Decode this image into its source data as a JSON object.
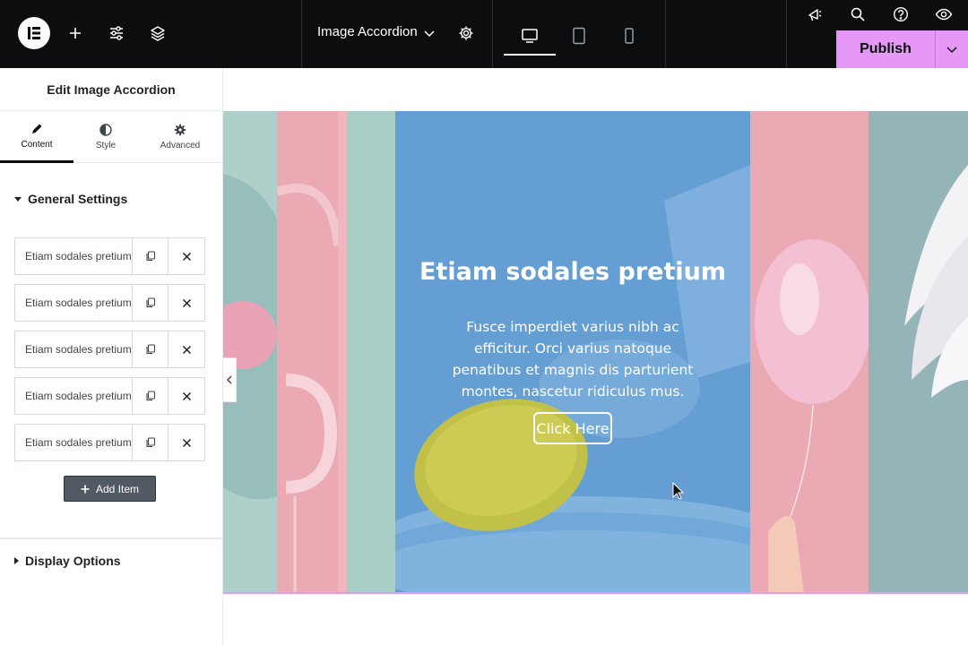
{
  "topbar": {
    "document_title": "Image Accordion",
    "publish_label": "Publish",
    "icons": [
      "elementor-logo-icon",
      "plus-icon",
      "sliders-icon",
      "layers-icon",
      "chevron-down-icon",
      "gear-icon",
      "desktop-icon",
      "tablet-icon",
      "mobile-icon",
      "megaphone-icon",
      "search-icon",
      "help-icon",
      "eye-icon"
    ],
    "accent": "#e598f5"
  },
  "panel": {
    "title": "Edit Image Accordion",
    "tabs": [
      {
        "label": "Content",
        "active": true
      },
      {
        "label": "Style",
        "active": false
      },
      {
        "label": "Advanced",
        "active": false
      }
    ],
    "general_settings_label": "General Settings",
    "items": [
      {
        "label": "Etiam sodales pretium"
      },
      {
        "label": "Etiam sodales pretium"
      },
      {
        "label": "Etiam sodales pretium"
      },
      {
        "label": "Etiam sodales pretium"
      },
      {
        "label": "Etiam sodales pretium"
      }
    ],
    "add_item_label": "Add Item",
    "display_options_label": "Display Options"
  },
  "accordion": {
    "active_title": "Etiam sodales pretium",
    "active_description": "Fusce imperdiet varius nibh ac efficitur. Orci varius natoque penatibus et magnis dis parturient montes, nascetur ridiculus mus.",
    "button_label": "Click Here",
    "colors": {
      "pink": "#eba9b3",
      "teal": "#9ec4be",
      "blue": "#6fa7db"
    }
  }
}
